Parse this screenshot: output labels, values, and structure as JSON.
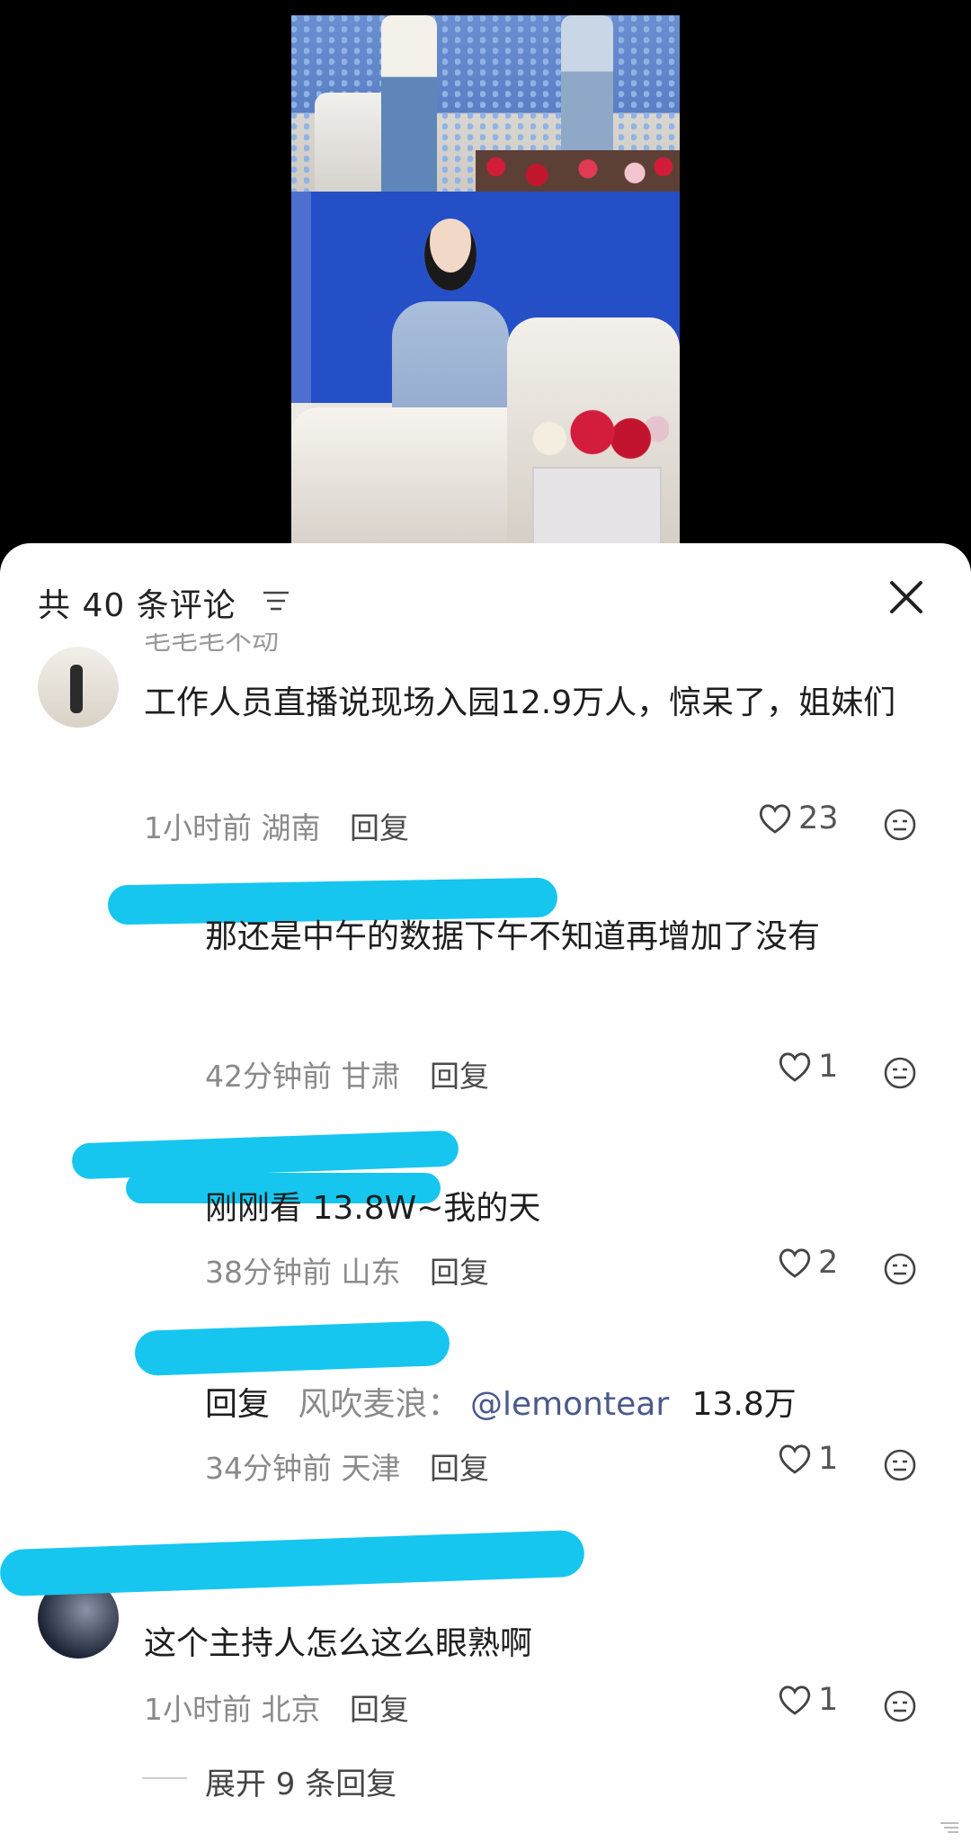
{
  "header": {
    "count_label": "共 40 条评论"
  },
  "comments": [
    {
      "username_partial": "毛毛毛不动",
      "text": "工作人员直播说现场入园12.9万人，惊呆了，姐妹们",
      "time": "1小时前",
      "location": "湖南",
      "reply_label": "回复",
      "likes": "23"
    },
    {
      "text": "那还是中午的数据下午不知道再增加了没有",
      "time": "42分钟前",
      "location": "甘肃",
      "reply_label": "回复",
      "likes": "1"
    },
    {
      "text": "刚刚看 13.8W~我的天",
      "time": "38分钟前",
      "location": "山东",
      "reply_label": "回复",
      "likes": "2"
    },
    {
      "text_prefix": "回复",
      "reply_to": "风吹麦浪：",
      "mention": "@lemontear",
      "text_suffix": "13.8万",
      "time": "34分钟前",
      "location": "天津",
      "reply_label": "回复",
      "likes": "1"
    },
    {
      "text": "这个主持人怎么这么眼熟啊",
      "time": "1小时前",
      "location": "北京",
      "reply_label": "回复",
      "likes": "1"
    }
  ],
  "expand_label": "展开 9 条回复",
  "icons": {
    "sort": "sort-icon",
    "close": "close-icon",
    "like": "heart-icon",
    "emoji": "emoji-icon"
  },
  "colors": {
    "redaction": "#16c6ef",
    "mention": "#4a5a8c"
  }
}
